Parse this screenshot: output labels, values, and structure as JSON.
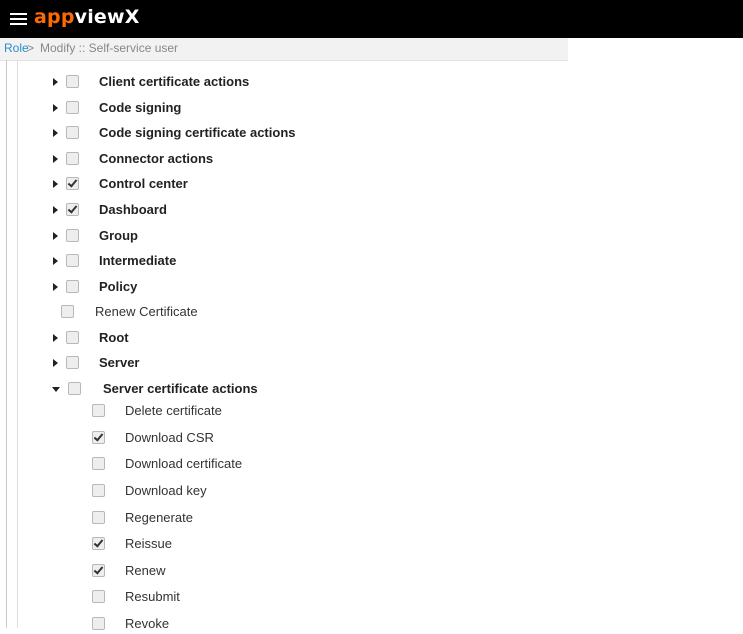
{
  "app": {
    "logo_part1": "app",
    "logo_part2": "viewX"
  },
  "breadcrumb": {
    "root": "Role",
    "separator": ">",
    "current": "Modify :: Self-service user"
  },
  "tree": [
    {
      "label": "Client certificate actions",
      "checked": false,
      "expandable": true,
      "expanded": false
    },
    {
      "label": "Code signing",
      "checked": false,
      "expandable": true,
      "expanded": false
    },
    {
      "label": "Code signing certificate actions",
      "checked": false,
      "expandable": true,
      "expanded": false
    },
    {
      "label": "Connector actions",
      "checked": false,
      "expandable": true,
      "expanded": false
    },
    {
      "label": "Control center",
      "checked": true,
      "expandable": true,
      "expanded": false
    },
    {
      "label": "Dashboard",
      "checked": true,
      "expandable": true,
      "expanded": false
    },
    {
      "label": "Group",
      "checked": false,
      "expandable": true,
      "expanded": false
    },
    {
      "label": "Intermediate",
      "checked": false,
      "expandable": true,
      "expanded": false
    },
    {
      "label": "Policy",
      "checked": false,
      "expandable": true,
      "expanded": false
    },
    {
      "label": "Renew Certificate",
      "checked": false,
      "expandable": false,
      "expanded": false
    },
    {
      "label": "Root",
      "checked": false,
      "expandable": true,
      "expanded": false
    },
    {
      "label": "Server",
      "checked": false,
      "expandable": true,
      "expanded": false
    },
    {
      "label": "Server certificate actions",
      "checked": false,
      "expandable": true,
      "expanded": true
    },
    {
      "label": "Delete certificate",
      "checked": false,
      "child": true
    },
    {
      "label": "Download CSR",
      "checked": true,
      "child": true
    },
    {
      "label": "Download certificate",
      "checked": false,
      "child": true
    },
    {
      "label": "Download key",
      "checked": false,
      "child": true
    },
    {
      "label": "Regenerate",
      "checked": false,
      "child": true
    },
    {
      "label": "Reissue",
      "checked": true,
      "child": true
    },
    {
      "label": "Renew",
      "checked": true,
      "child": true
    },
    {
      "label": "Resubmit",
      "checked": false,
      "child": true
    },
    {
      "label": "Revoke",
      "checked": false,
      "child": true
    }
  ]
}
